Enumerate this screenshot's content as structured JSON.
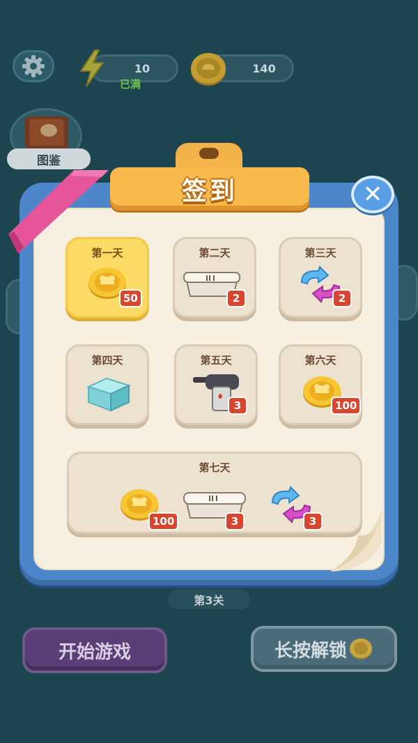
{
  "hud": {
    "energy_value": "10",
    "energy_status": "已满",
    "coins_value": "140",
    "book_label": "图鉴"
  },
  "popup": {
    "title": "签到",
    "close_glyph": "✕"
  },
  "days": [
    {
      "label": "第一天",
      "reward": "coin",
      "count": "50"
    },
    {
      "label": "第二天",
      "reward": "food-box",
      "count": "2"
    },
    {
      "label": "第三天",
      "reward": "swap",
      "count": "2"
    },
    {
      "label": "第四天",
      "reward": "ice-cube"
    },
    {
      "label": "第五天",
      "reward": "glue-gun",
      "count": "3"
    },
    {
      "label": "第六天",
      "reward": "coin",
      "count": "100"
    },
    {
      "label": "第七天",
      "rewards": [
        {
          "reward": "coin",
          "count": "100"
        },
        {
          "reward": "food-box",
          "count": "3"
        },
        {
          "reward": "swap",
          "count": "3"
        }
      ]
    }
  ],
  "level_label": "第3关",
  "buttons": {
    "start": "开始游戏",
    "unlock": "长按解锁"
  }
}
